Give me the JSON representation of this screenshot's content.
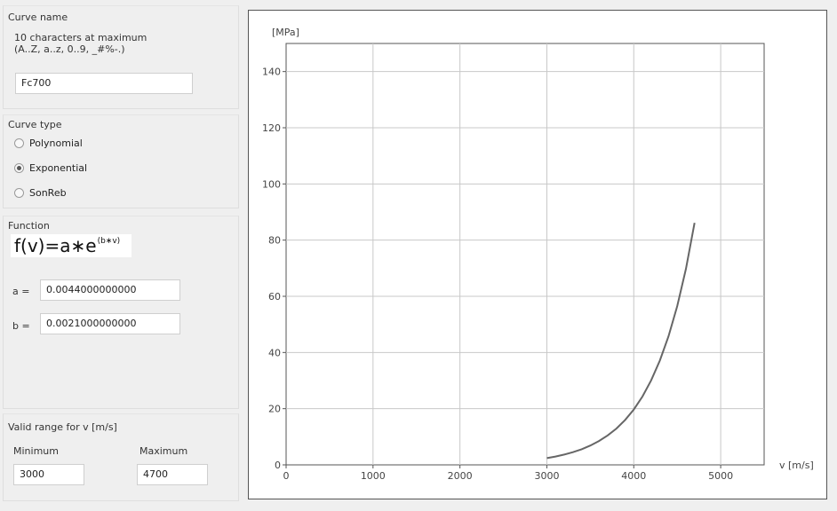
{
  "curve_name": {
    "title": "Curve name",
    "hint_line1": "10 characters at maximum",
    "hint_line2": "(A..Z, a..z, 0..9, _#%-.)",
    "value": "Fc700"
  },
  "curve_type": {
    "title": "Curve type",
    "options": [
      {
        "label": "Polynomial",
        "checked": false
      },
      {
        "label": "Exponential",
        "checked": true
      },
      {
        "label": "SonReb",
        "checked": false
      }
    ]
  },
  "function": {
    "title": "Function",
    "formula_lhs": "f(v)=a∗e",
    "formula_exp": "(b∗v)",
    "a_label": "a =",
    "a_value": "0.0044000000000",
    "b_label": "b =",
    "b_value": "0.0021000000000"
  },
  "valid_range": {
    "title": "Valid range for v [m/s]",
    "min_label": "Minimum",
    "max_label": "Maximum",
    "min_value": "3000",
    "max_value": "4700"
  },
  "chart_data": {
    "type": "line",
    "ylabel": "[MPa]",
    "xlabel": "v [m/s]",
    "xlim": [
      0,
      5500
    ],
    "ylim": [
      0,
      150
    ],
    "xticks": [
      0,
      1000,
      2000,
      3000,
      4000,
      5000
    ],
    "yticks": [
      0,
      20,
      40,
      60,
      80,
      100,
      120,
      140
    ],
    "grid": true,
    "line_color": "#666666",
    "series": [
      {
        "x": [
          3000,
          3100,
          3200,
          3300,
          3400,
          3500,
          3600,
          3700,
          3800,
          3900,
          4000,
          4100,
          4200,
          4300,
          4400,
          4500,
          4600,
          4700
        ],
        "y": [
          2.4,
          2.96,
          3.65,
          4.51,
          5.57,
          6.87,
          8.49,
          10.48,
          12.93,
          15.97,
          19.71,
          24.34,
          30.05,
          37.09,
          45.79,
          56.53,
          69.79,
          86.16
        ]
      }
    ]
  }
}
